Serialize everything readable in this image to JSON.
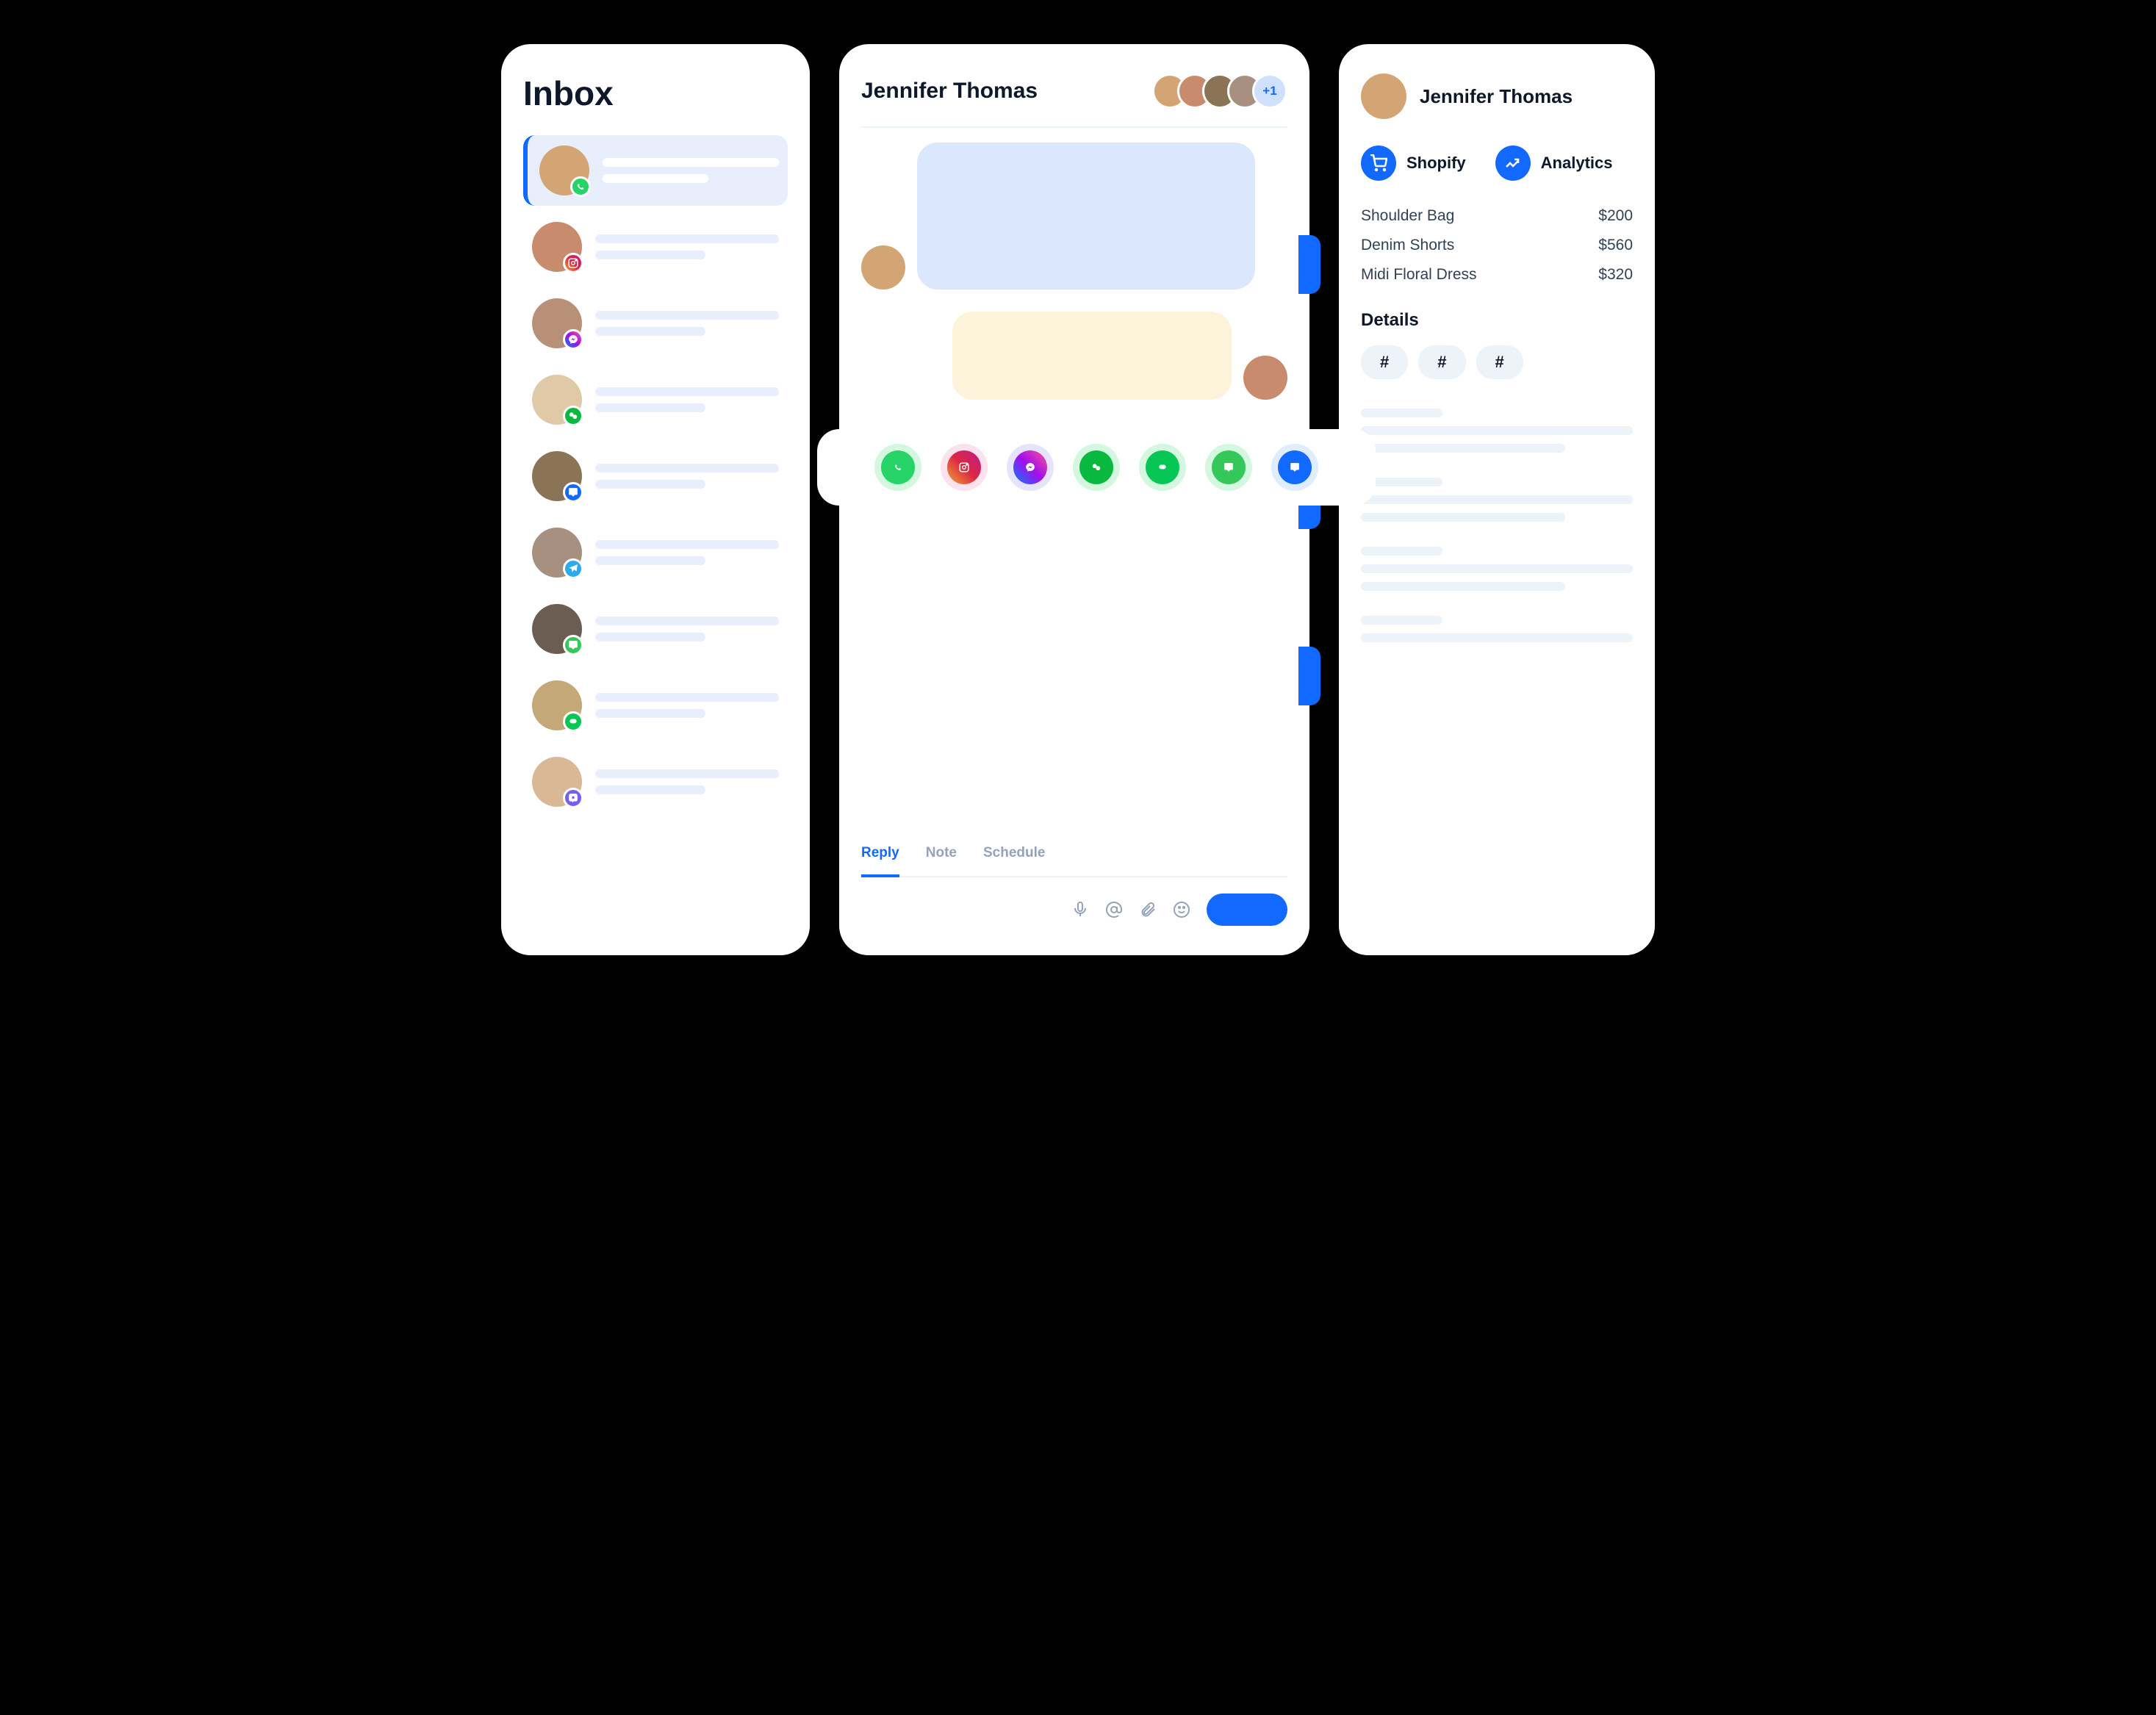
{
  "inbox": {
    "title": "Inbox",
    "items": [
      {
        "channel": "whatsapp",
        "active": true
      },
      {
        "channel": "instagram",
        "active": false
      },
      {
        "channel": "messenger",
        "active": false
      },
      {
        "channel": "wechat",
        "active": false
      },
      {
        "channel": "sms",
        "active": false
      },
      {
        "channel": "telegram",
        "active": false
      },
      {
        "channel": "imessage",
        "active": false
      },
      {
        "channel": "line",
        "active": false
      },
      {
        "channel": "viber",
        "active": false
      }
    ]
  },
  "chat": {
    "contact_name": "Jennifer Thomas",
    "participants_more": "+1",
    "composer": {
      "tabs": {
        "reply": "Reply",
        "note": "Note",
        "schedule": "Schedule"
      },
      "active_tab": "reply"
    },
    "channels": [
      "whatsapp",
      "instagram",
      "messenger",
      "wechat",
      "line",
      "imessage",
      "sms"
    ]
  },
  "details": {
    "name": "Jennifer Thomas",
    "integrations": {
      "shopify": "Shopify",
      "analytics": "Analytics"
    },
    "purchases": [
      {
        "item": "Shoulder Bag",
        "price": "$200"
      },
      {
        "item": "Denim Shorts",
        "price": "$560"
      },
      {
        "item": "Midi Floral Dress",
        "price": "$320"
      }
    ],
    "section_details": "Details",
    "tags": [
      "#",
      "#",
      "#"
    ]
  },
  "avatar_colors": [
    "#d4a574",
    "#c98b6e",
    "#b89078",
    "#e0c9a6",
    "#8b7355",
    "#a89080",
    "#6b5d52",
    "#c4a878",
    "#d9b896"
  ]
}
